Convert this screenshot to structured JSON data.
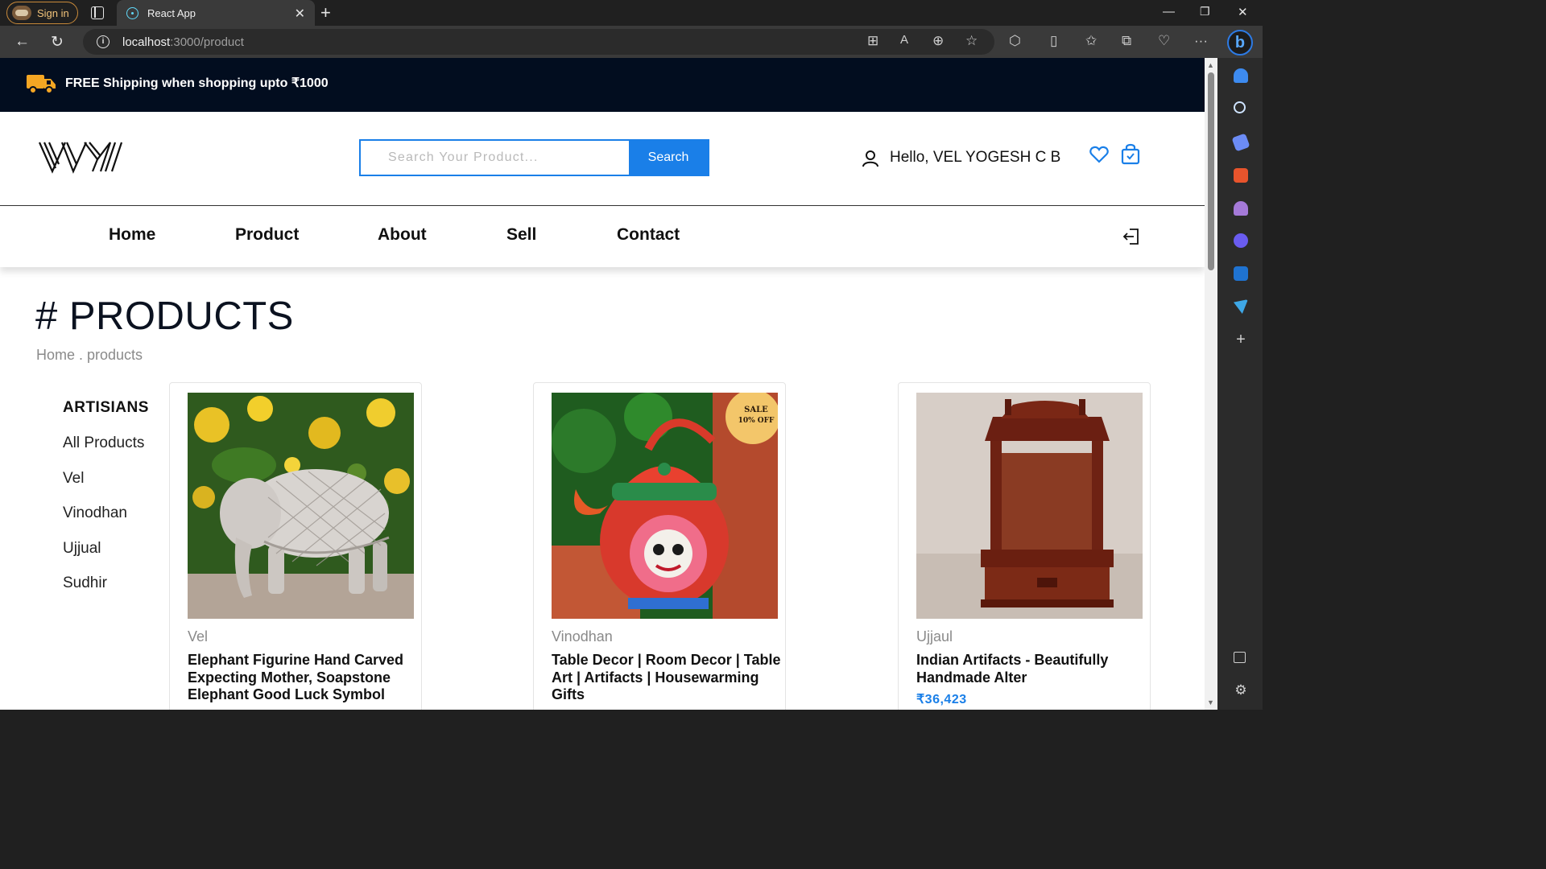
{
  "browser": {
    "signin_label": "Sign in",
    "tab_title": "React App",
    "url_host": "localhost",
    "url_path": ":3000/product"
  },
  "promo": {
    "text": "FREE Shipping when shopping upto ₹1000"
  },
  "header": {
    "search_placeholder": "Search Your Product...",
    "search_button": "Search",
    "greeting": "Hello, VEL YOGESH C B"
  },
  "nav": {
    "items": [
      {
        "label": "Home"
      },
      {
        "label": "Product"
      },
      {
        "label": "About"
      },
      {
        "label": "Sell"
      },
      {
        "label": "Contact"
      }
    ]
  },
  "page": {
    "title": "# PRODUCTS",
    "breadcrumb": "Home . products"
  },
  "filters": {
    "heading": "ARTISIANS",
    "options": [
      "All Products",
      "Vel",
      "Vinodhan",
      "Ujjual",
      "Sudhir"
    ]
  },
  "products": [
    {
      "artisan": "Vel",
      "title": "Elephant Figurine Hand Carved Expecting Mother, Soapstone Elephant Good Luck Symbol",
      "price": ""
    },
    {
      "artisan": "Vinodhan",
      "title": "Table Decor | Room Decor | Table Art | Artifacts | Housewarming Gifts",
      "price": "",
      "badge_line1": "SALE",
      "badge_line2": "10% OFF"
    },
    {
      "artisan": "Ujjaul",
      "title": "Indian Artifacts - Beautifully Handmade Alter",
      "price": "₹36,423"
    }
  ],
  "colors": {
    "accent": "#1a7fe8",
    "promo_bg": "#020d1f"
  }
}
